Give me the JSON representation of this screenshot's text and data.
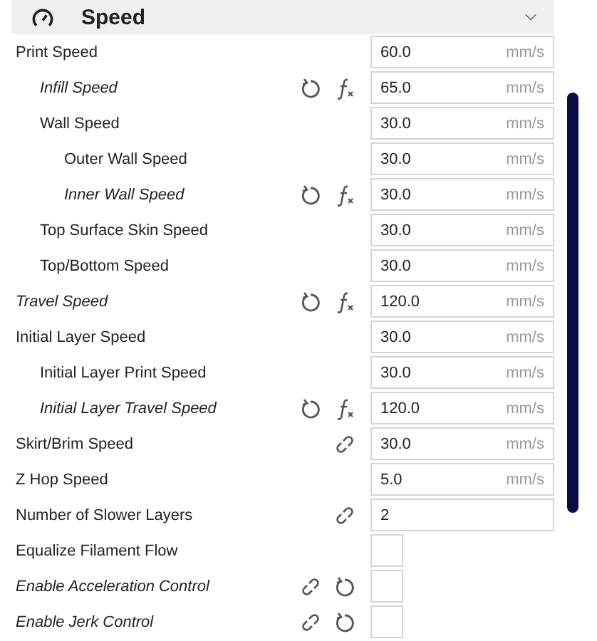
{
  "section": {
    "title": "Speed",
    "expanded": true
  },
  "settings": [
    {
      "label": "Print Speed",
      "modified": false,
      "linked": false,
      "resettable": false,
      "has_formula": false,
      "field": {
        "kind": "number",
        "value": "60.0",
        "unit": "mm/s"
      },
      "children": [
        {
          "label": "Infill Speed",
          "modified": true,
          "linked": false,
          "resettable": true,
          "has_formula": true,
          "field": {
            "kind": "number",
            "value": "65.0",
            "unit": "mm/s"
          }
        },
        {
          "label": "Wall Speed",
          "modified": false,
          "linked": false,
          "resettable": false,
          "has_formula": false,
          "field": {
            "kind": "number",
            "value": "30.0",
            "unit": "mm/s"
          },
          "children": [
            {
              "label": "Outer Wall Speed",
              "modified": false,
              "linked": false,
              "resettable": false,
              "has_formula": false,
              "field": {
                "kind": "number",
                "value": "30.0",
                "unit": "mm/s"
              }
            },
            {
              "label": "Inner Wall Speed",
              "modified": true,
              "linked": false,
              "resettable": true,
              "has_formula": true,
              "field": {
                "kind": "number",
                "value": "30.0",
                "unit": "mm/s"
              }
            }
          ]
        },
        {
          "label": "Top Surface Skin Speed",
          "modified": false,
          "linked": false,
          "resettable": false,
          "has_formula": false,
          "field": {
            "kind": "number",
            "value": "30.0",
            "unit": "mm/s"
          }
        },
        {
          "label": "Top/Bottom Speed",
          "modified": false,
          "linked": false,
          "resettable": false,
          "has_formula": false,
          "field": {
            "kind": "number",
            "value": "30.0",
            "unit": "mm/s"
          }
        }
      ]
    },
    {
      "label": "Travel Speed",
      "modified": true,
      "linked": false,
      "resettable": true,
      "has_formula": true,
      "field": {
        "kind": "number",
        "value": "120.0",
        "unit": "mm/s"
      }
    },
    {
      "label": "Initial Layer Speed",
      "modified": false,
      "linked": false,
      "resettable": false,
      "has_formula": false,
      "field": {
        "kind": "number",
        "value": "30.0",
        "unit": "mm/s"
      },
      "children": [
        {
          "label": "Initial Layer Print Speed",
          "modified": false,
          "linked": false,
          "resettable": false,
          "has_formula": false,
          "field": {
            "kind": "number",
            "value": "30.0",
            "unit": "mm/s"
          }
        },
        {
          "label": "Initial Layer Travel Speed",
          "modified": true,
          "linked": false,
          "resettable": true,
          "has_formula": true,
          "field": {
            "kind": "number",
            "value": "120.0",
            "unit": "mm/s"
          }
        }
      ]
    },
    {
      "label": "Skirt/Brim Speed",
      "modified": false,
      "linked": true,
      "resettable": false,
      "has_formula": false,
      "field": {
        "kind": "number",
        "value": "30.0",
        "unit": "mm/s"
      }
    },
    {
      "label": "Z Hop Speed",
      "modified": false,
      "linked": false,
      "resettable": false,
      "has_formula": false,
      "field": {
        "kind": "number",
        "value": "5.0",
        "unit": "mm/s"
      }
    },
    {
      "label": "Number of Slower Layers",
      "modified": false,
      "linked": true,
      "resettable": false,
      "has_formula": false,
      "field": {
        "kind": "number",
        "value": "2"
      }
    },
    {
      "label": "Equalize Filament Flow",
      "modified": false,
      "linked": false,
      "resettable": false,
      "has_formula": false,
      "field": {
        "kind": "checkbox",
        "checked": false
      }
    },
    {
      "label": "Enable Acceleration Control",
      "modified": true,
      "linked": true,
      "resettable": true,
      "has_formula": false,
      "field": {
        "kind": "checkbox",
        "checked": false
      }
    },
    {
      "label": "Enable Jerk Control",
      "modified": true,
      "linked": true,
      "resettable": true,
      "has_formula": false,
      "field": {
        "kind": "checkbox",
        "checked": false
      }
    }
  ]
}
